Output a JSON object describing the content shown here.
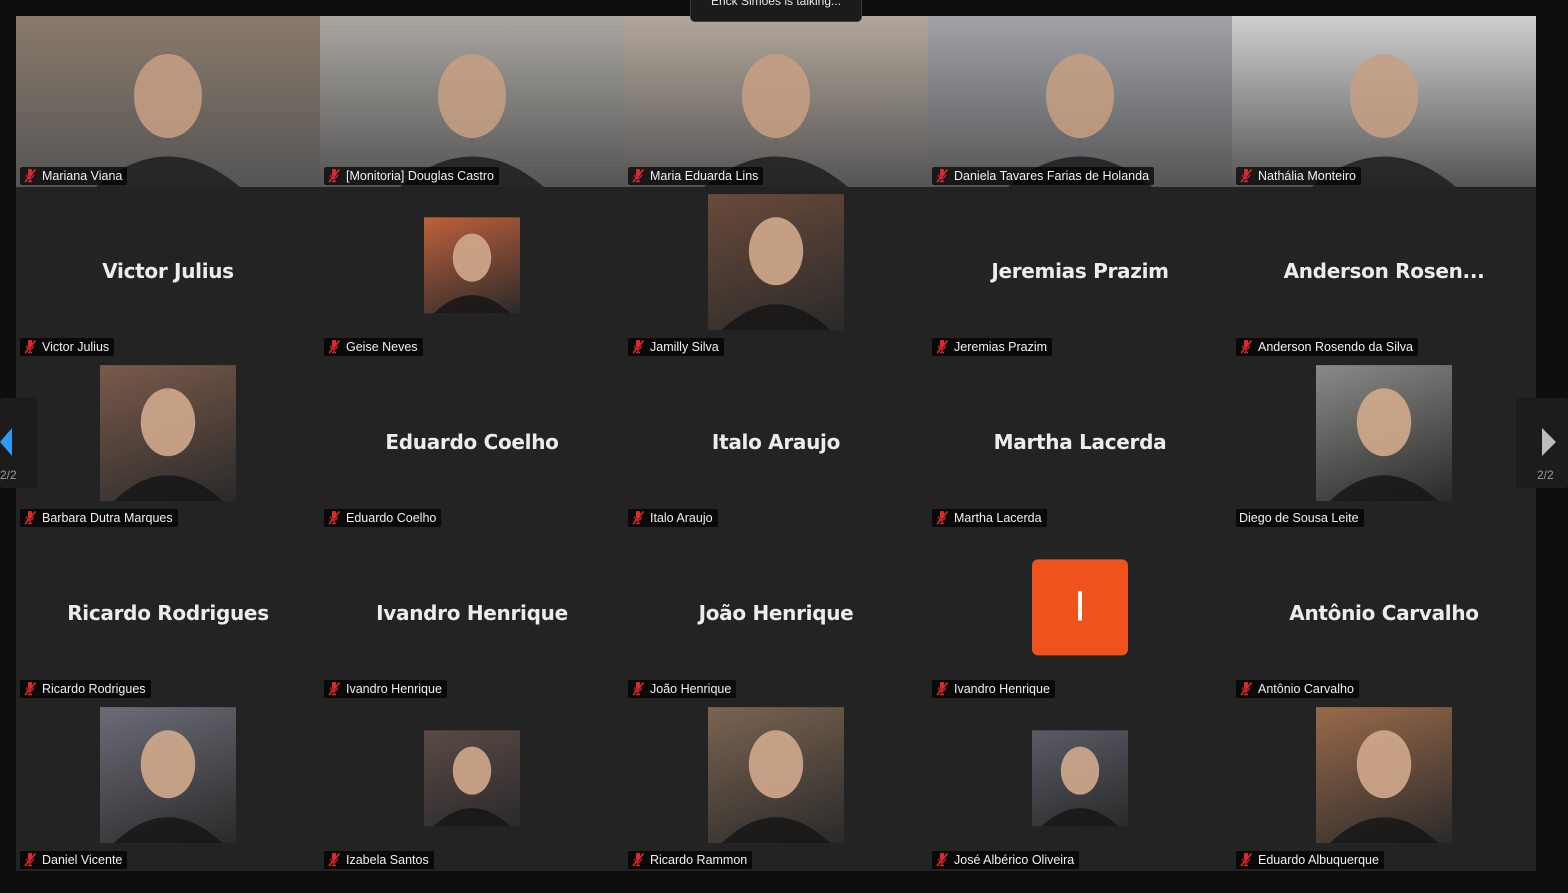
{
  "talking_indicator": "Erick Simões is talking...",
  "page_indicator_left": "2/2",
  "page_indicator_right": "2/2",
  "colors": {
    "mute_red": "#e02828",
    "initial_bg": "#f0521e",
    "tile_bg": "#232323"
  },
  "tiles": [
    {
      "label": "Mariana Viana",
      "kind": "video",
      "muted": true,
      "bg": "#8a7a6a"
    },
    {
      "label": "[Monitoria] Douglas Castro",
      "kind": "video",
      "muted": true,
      "bg": "#a9a6a0"
    },
    {
      "label": "Maria Eduarda Lins",
      "kind": "video",
      "muted": true,
      "bg": "#b3a79a"
    },
    {
      "label": "Daniela Tavares Farias de Holanda",
      "kind": "video",
      "muted": true,
      "bg": "#a0a2a8"
    },
    {
      "label": "Nathália Monteiro",
      "kind": "video",
      "muted": true,
      "bg": "#cfcfcf"
    },
    {
      "label": "Victor Julius",
      "kind": "name",
      "display": "Victor Julius",
      "muted": true
    },
    {
      "label": "Geise Neves",
      "kind": "avatar-small",
      "muted": true,
      "bg": "#c0603a"
    },
    {
      "label": "Jamilly Silva",
      "kind": "avatar-large",
      "muted": true,
      "bg": "#6a4a3a"
    },
    {
      "label": "Jeremias Prazim",
      "kind": "name",
      "display": "Jeremias Prazim",
      "muted": true
    },
    {
      "label": "Anderson Rosendo da Silva",
      "kind": "name",
      "display": "Anderson  Rosen...",
      "muted": true
    },
    {
      "label": "Barbara Dutra Marques",
      "kind": "avatar-large",
      "muted": true,
      "bg": "#7a5a4a"
    },
    {
      "label": "Eduardo Coelho",
      "kind": "name",
      "display": "Eduardo Coelho",
      "muted": true
    },
    {
      "label": "Italo Araujo",
      "kind": "name",
      "display": "Italo Araujo",
      "muted": true
    },
    {
      "label": "Martha Lacerda",
      "kind": "name",
      "display": "Martha Lacerda",
      "muted": true
    },
    {
      "label": "Diego de Sousa Leite",
      "kind": "avatar-large",
      "muted": false,
      "bg": "#8a8a88"
    },
    {
      "label": "Ricardo Rodrigues",
      "kind": "name",
      "display": "Ricardo Rodrigues",
      "muted": true
    },
    {
      "label": "Ivandro Henrique",
      "kind": "name",
      "display": "Ivandro Henrique",
      "muted": true
    },
    {
      "label": "João Henrique",
      "kind": "name",
      "display": "João Henrique",
      "muted": true
    },
    {
      "label": "Ivandro Henrique",
      "kind": "initial",
      "display": "I",
      "muted": true
    },
    {
      "label": "Antônio Carvalho",
      "kind": "name",
      "display": "Antônio Carvalho",
      "muted": true
    },
    {
      "label": "Daniel Vicente",
      "kind": "avatar-large",
      "muted": true,
      "bg": "#6c6c78"
    },
    {
      "label": "Izabela Santos",
      "kind": "avatar-small",
      "muted": true,
      "bg": "#5a4a46"
    },
    {
      "label": "Ricardo Rammon",
      "kind": "avatar-large",
      "muted": true,
      "bg": "#7a6450"
    },
    {
      "label": "José Albérico Oliveira",
      "kind": "avatar-small",
      "muted": true,
      "bg": "#5a5c66"
    },
    {
      "label": "Eduardo Albuquerque",
      "kind": "avatar-large",
      "muted": true,
      "bg": "#9a6a4a"
    }
  ]
}
